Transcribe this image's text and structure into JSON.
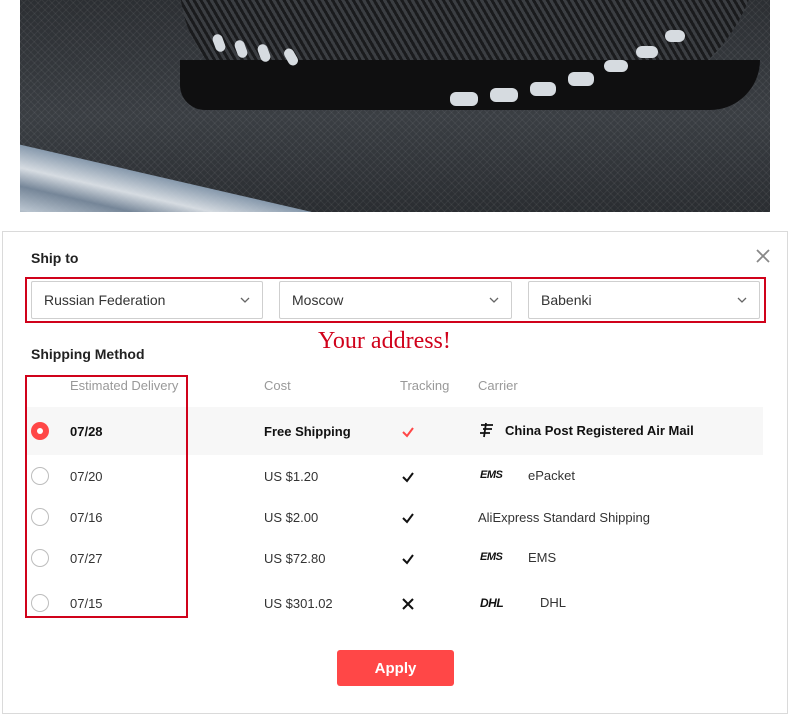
{
  "header": {
    "title": "Ship to"
  },
  "address": {
    "country": "Russian Federation",
    "city": "Moscow",
    "district": "Babenki",
    "annotation": "Your address!"
  },
  "shipping": {
    "title": "Shipping Method",
    "columns": [
      "Estimated Delivery",
      "Cost",
      "Tracking",
      "Carrier"
    ],
    "rows": [
      {
        "date": "07/28",
        "cost": "Free Shipping",
        "tracking": "check-red",
        "carrier": "China Post Registered Air Mail",
        "selected": true
      },
      {
        "date": "07/20",
        "cost": "US $1.20",
        "tracking": "check",
        "carrier": "ePacket",
        "selected": false
      },
      {
        "date": "07/16",
        "cost": "US $2.00",
        "tracking": "check",
        "carrier": "AliExpress Standard Shipping",
        "selected": false
      },
      {
        "date": "07/27",
        "cost": "US $72.80",
        "tracking": "check",
        "carrier": "EMS",
        "selected": false
      },
      {
        "date": "07/15",
        "cost": "US $301.02",
        "tracking": "cross",
        "carrier": "DHL",
        "selected": false
      }
    ]
  },
  "logos": {
    "ems": "EMS",
    "dhl": "DHL"
  },
  "apply_label": "Apply",
  "colors": {
    "accent": "#ff4747",
    "annotation": "#d0021b"
  }
}
